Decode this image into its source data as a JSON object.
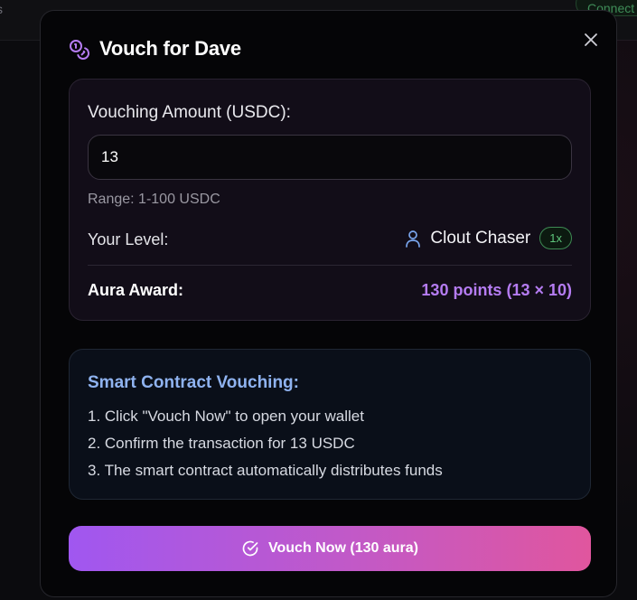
{
  "background": {
    "left_fragment": "s",
    "connect_label": "Connect"
  },
  "modal": {
    "title": "Vouch for Dave",
    "amount": {
      "label": "Vouching Amount (USDC):",
      "value": "13",
      "range_text": "Range: 1-100 USDC"
    },
    "level": {
      "label": "Your Level:",
      "name": "Clout Chaser",
      "multiplier": "1x"
    },
    "aura": {
      "label": "Aura Award:",
      "value": "130 points (13 × 10)"
    },
    "smart_contract": {
      "title": "Smart Contract Vouching:",
      "steps": [
        "1. Click \"Vouch Now\" to open your wallet",
        "2. Confirm the transaction for 13 USDC",
        "3. The smart contract automatically distributes funds"
      ]
    },
    "vouch_button_label": "Vouch Now (130 aura)"
  },
  "colors": {
    "accent_purple": "#b57cf2",
    "info_blue": "#8fb3f0",
    "badge_green": "#5fc67c",
    "button_gradient_start": "#a057f0",
    "button_gradient_end": "#e0569e"
  },
  "icons": {
    "title": "coins-icon",
    "close": "close-icon",
    "level": "user-icon",
    "button": "check-circle-icon"
  }
}
